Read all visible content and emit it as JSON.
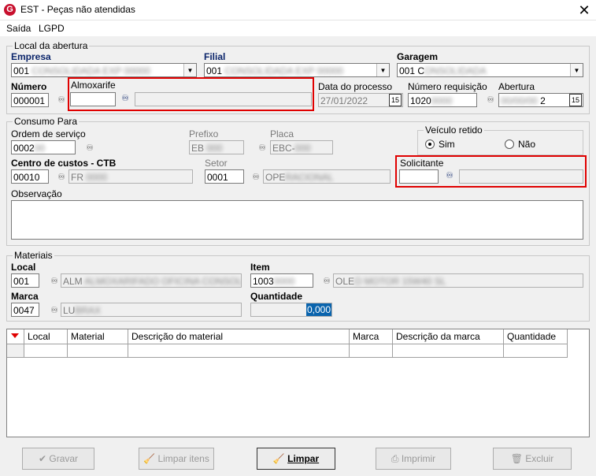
{
  "window": {
    "title": "EST - Peças não atendidas",
    "app_icon_letter": "G"
  },
  "menu": {
    "items": [
      "Saída",
      "LGPD"
    ]
  },
  "local_abertura": {
    "legend": "Local da abertura",
    "empresa": {
      "label": "Empresa",
      "value": "001"
    },
    "filial": {
      "label": "Filial",
      "value": "001"
    },
    "garagem": {
      "label": "Garagem",
      "value": "001 C"
    },
    "numero": {
      "label": "Número",
      "value": "000001"
    },
    "almoxarife": {
      "label": "Almoxarife",
      "value": ""
    },
    "data_processo": {
      "label": "Data do processo",
      "value": "27/01/2022"
    },
    "numero_requisicao": {
      "label": "Número requisição",
      "value": "1020"
    },
    "abertura": {
      "label": "Abertura",
      "value": "2"
    }
  },
  "consumo_para": {
    "legend": "Consumo Para",
    "ordem_servico": {
      "label": "Ordem de serviço",
      "value": "0002"
    },
    "prefixo": {
      "label": "Prefixo",
      "value": "EB"
    },
    "placa": {
      "label": "Placa",
      "value": "EBC-"
    },
    "veiculo_retido": {
      "label": "Veículo retido",
      "sim": "Sim",
      "nao": "Não",
      "selected": "Sim"
    },
    "centro_custos": {
      "label": "Centro de custos - CTB",
      "value": "00010",
      "desc": "FR"
    },
    "setor": {
      "label": "Setor",
      "value": "0001",
      "desc": "OPE"
    },
    "solicitante": {
      "label": "Solicitante",
      "value": ""
    },
    "observacao": {
      "label": "Observação",
      "value": ""
    }
  },
  "materiais": {
    "legend": "Materiais",
    "local": {
      "label": "Local",
      "value": "001",
      "desc": "ALM"
    },
    "item": {
      "label": "Item",
      "value": "1003",
      "desc": "OLE"
    },
    "marca": {
      "label": "Marca",
      "value": "0047",
      "desc": "LU"
    },
    "quantidade": {
      "label": "Quantidade",
      "value": "0,000"
    }
  },
  "grid": {
    "columns": [
      "Local",
      "Material",
      "Descrição do material",
      "Marca",
      "Descrição da marca",
      "Quantidade"
    ]
  },
  "buttons": {
    "gravar": "Gravar",
    "limpar_itens": "Limpar itens",
    "limpar": "Limpar",
    "imprimir": "Imprimir",
    "excluir": "Excluir"
  },
  "icons": {
    "app": "app-logo-icon",
    "close": "close-icon",
    "binoculars": "binoculars-icon",
    "calendar": "calendar-icon",
    "dropdown": "chevron-down-icon"
  }
}
